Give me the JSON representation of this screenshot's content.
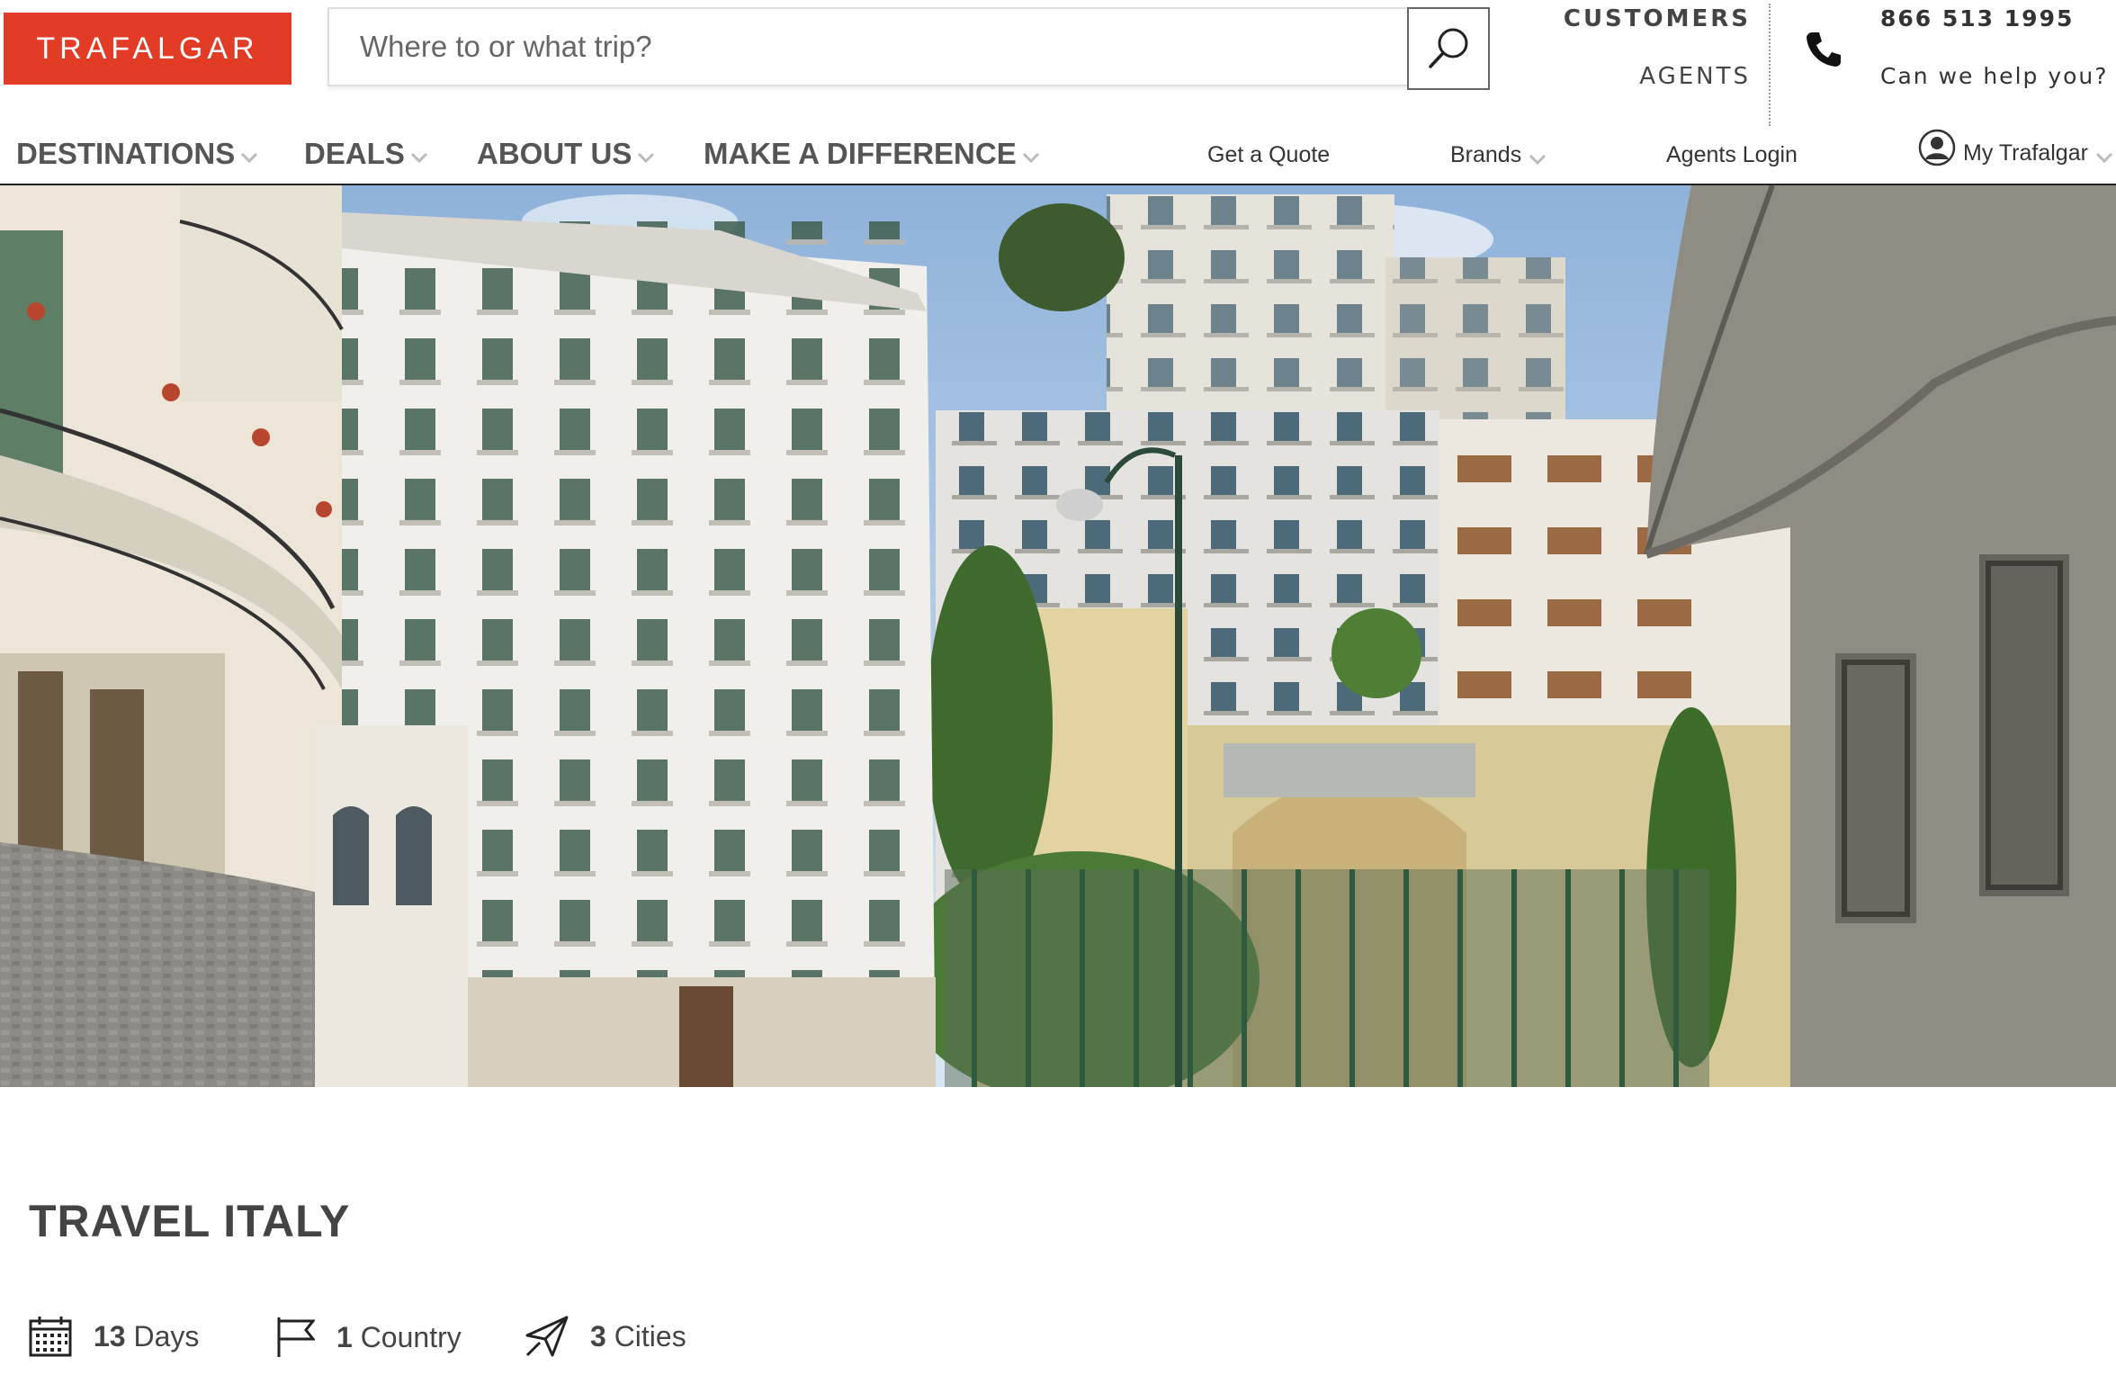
{
  "brand": {
    "logo_text": "TRAFALGAR",
    "accent_color": "#e23b26"
  },
  "search": {
    "placeholder": "Where to or what trip?",
    "icon": "search-icon"
  },
  "audience": {
    "customers": "CUSTOMERS",
    "agents": "AGENTS"
  },
  "contact": {
    "phone": "866 513 1995",
    "help": "Can we help you?",
    "icon": "phone-icon"
  },
  "nav": {
    "main": [
      {
        "label": "DESTINATIONS"
      },
      {
        "label": "DEALS"
      },
      {
        "label": "ABOUT US"
      },
      {
        "label": "MAKE A DIFFERENCE"
      }
    ],
    "secondary": {
      "quote": "Get a Quote",
      "brands": "Brands",
      "agents_login": "Agents Login",
      "my_account": "My Trafalgar"
    }
  },
  "trip": {
    "title": "TRAVEL ITALY",
    "days": {
      "value": "13",
      "unit": "Days"
    },
    "countries": {
      "value": "1",
      "unit": "Country"
    },
    "cities": {
      "value": "3",
      "unit": "Cities"
    }
  }
}
